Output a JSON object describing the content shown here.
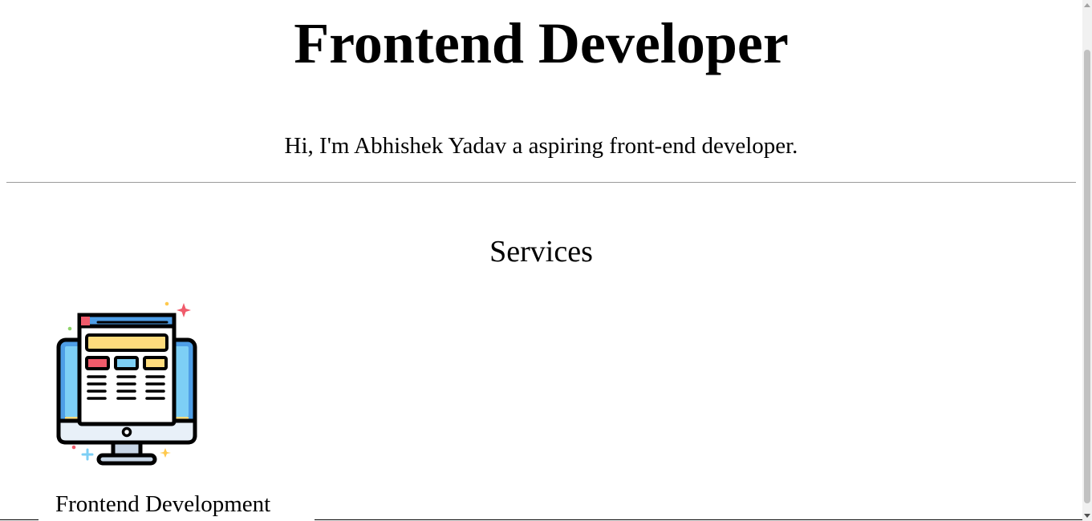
{
  "header": {
    "title": "Frontend Developer",
    "intro": "Hi, I'm Abhishek Yadav a aspiring front-end developer."
  },
  "services": {
    "heading": "Services",
    "items": [
      {
        "label": "Frontend Development",
        "icon": "monitor-web-design-icon"
      }
    ]
  },
  "colors": {
    "background": "#ffffff",
    "text": "#000000",
    "divider": "#9a9a9a",
    "icon_screen": "#4e9ee6",
    "icon_screen_light": "#7dcff5",
    "icon_red": "#f05b6b",
    "icon_yellow": "#ffdc7d",
    "icon_blue": "#7dcff5",
    "icon_base": "#e8f0f8",
    "icon_stand": "#c8d6e6"
  }
}
